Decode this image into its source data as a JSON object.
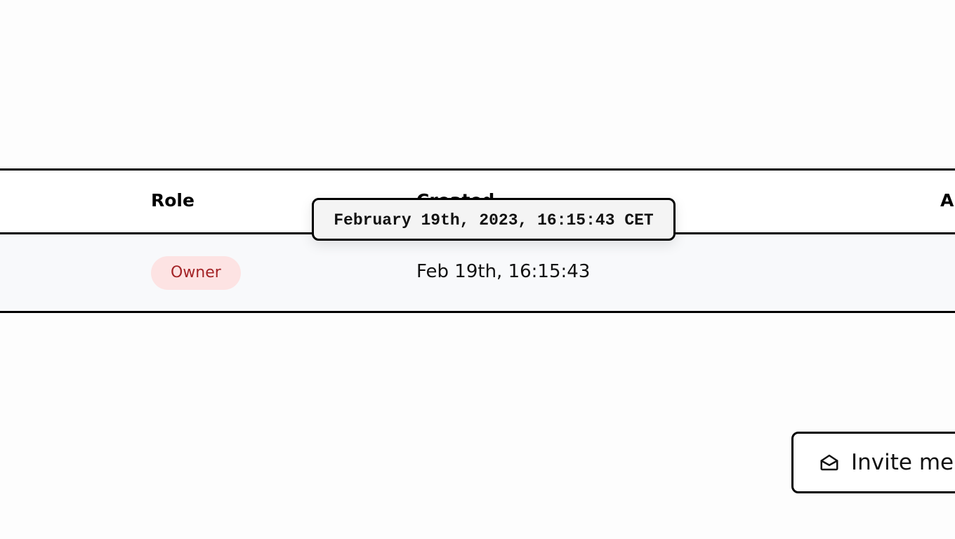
{
  "table": {
    "headers": {
      "role": "Role",
      "created": "Created",
      "actions": "A"
    },
    "rows": [
      {
        "role": "Owner",
        "created": "Feb 19th, 16:15:43"
      }
    ]
  },
  "tooltip": {
    "text": "February 19th, 2023, 16:15:43 CET"
  },
  "invite_button": {
    "label": "Invite me",
    "icon": "envelope-open-icon"
  },
  "colors": {
    "badge_bg": "#fde3e3",
    "badge_text": "#a32326",
    "row_bg": "#f8f9fb"
  }
}
